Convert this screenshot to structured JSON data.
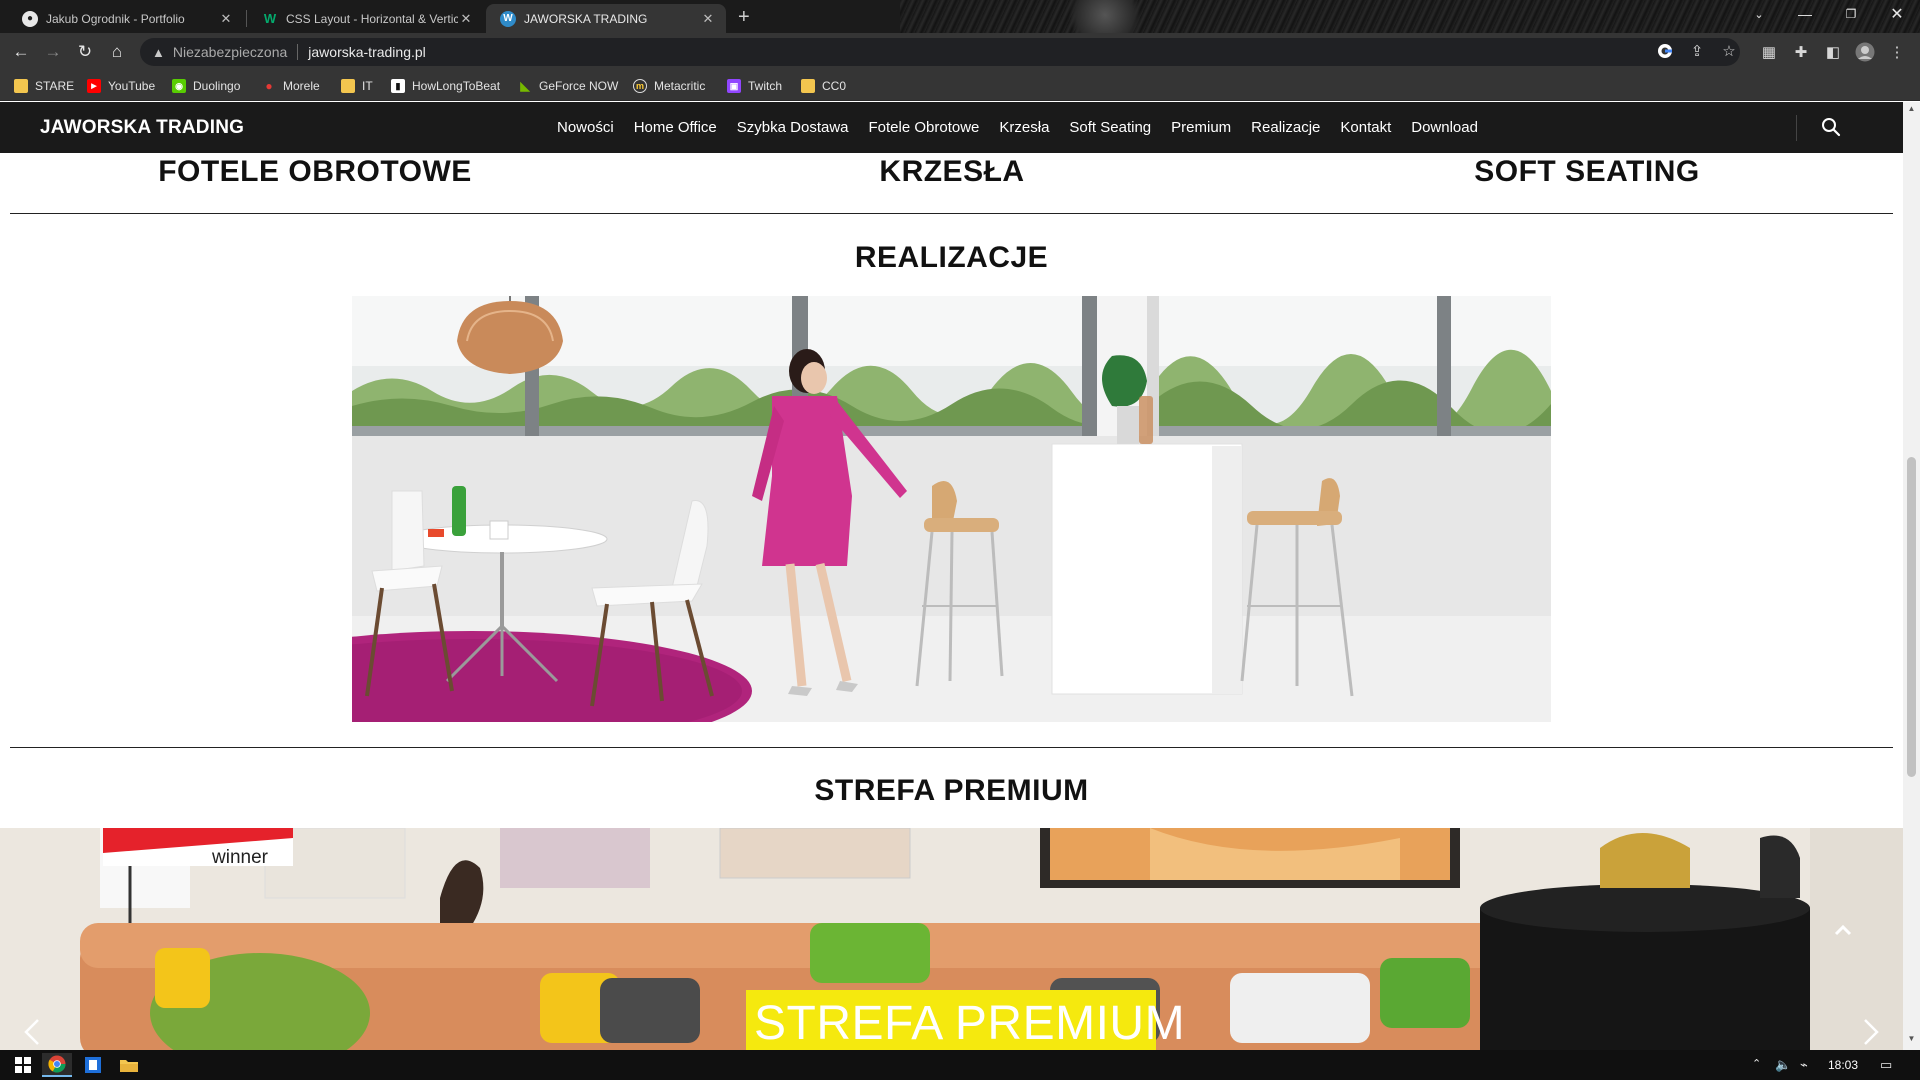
{
  "browser": {
    "tabs": [
      {
        "title": "Jakub Ogrodnik - Portfolio",
        "active": false,
        "icon": "github-icon"
      },
      {
        "title": "CSS Layout - Horizontal & Vertic",
        "active": false,
        "icon": "w3schools-icon"
      },
      {
        "title": "JAWORSKA TRADING",
        "active": true,
        "icon": "wordpress-icon"
      }
    ],
    "new_tab": "+",
    "address": {
      "security_label": "Niezabezpieczona",
      "url": "jaworska-trading.pl"
    },
    "bookmarks": [
      {
        "label": "STARE",
        "icon": "folder-icon"
      },
      {
        "label": "YouTube",
        "icon": "youtube-icon"
      },
      {
        "label": "Duolingo",
        "icon": "duolingo-icon"
      },
      {
        "label": "Morele",
        "icon": "morele-icon"
      },
      {
        "label": "IT",
        "icon": "folder-icon"
      },
      {
        "label": "HowLongToBeat",
        "icon": "howlongtobeat-icon"
      },
      {
        "label": "GeForce NOW",
        "icon": "nvidia-icon"
      },
      {
        "label": "Metacritic",
        "icon": "metacritic-icon"
      },
      {
        "label": "Twitch",
        "icon": "twitch-icon"
      },
      {
        "label": "CC0",
        "icon": "folder-icon"
      }
    ]
  },
  "site": {
    "brand": "JAWORSKA TRADING",
    "menu": [
      "Nowości",
      "Home Office",
      "Szybka Dostawa",
      "Fotele Obrotowe",
      "Krzesła",
      "Soft Seating",
      "Premium",
      "Realizacje",
      "Kontakt",
      "Download"
    ],
    "categories": [
      "FOTELE OBROTOWE",
      "KRZESŁA",
      "SOFT SEATING"
    ],
    "sections": {
      "realizacje": "REALIZACJE",
      "premium": "STREFA PREMIUM"
    },
    "premium_banner": "STREFA PREMIUM",
    "premium_tag": "winner"
  },
  "taskbar": {
    "time": "18:03"
  },
  "colors": {
    "nav_bg": "#1a1a1a",
    "banner_yellow": "#f5e90e",
    "rug_magenta": "#b0247c",
    "dress_pink": "#d0348f"
  }
}
